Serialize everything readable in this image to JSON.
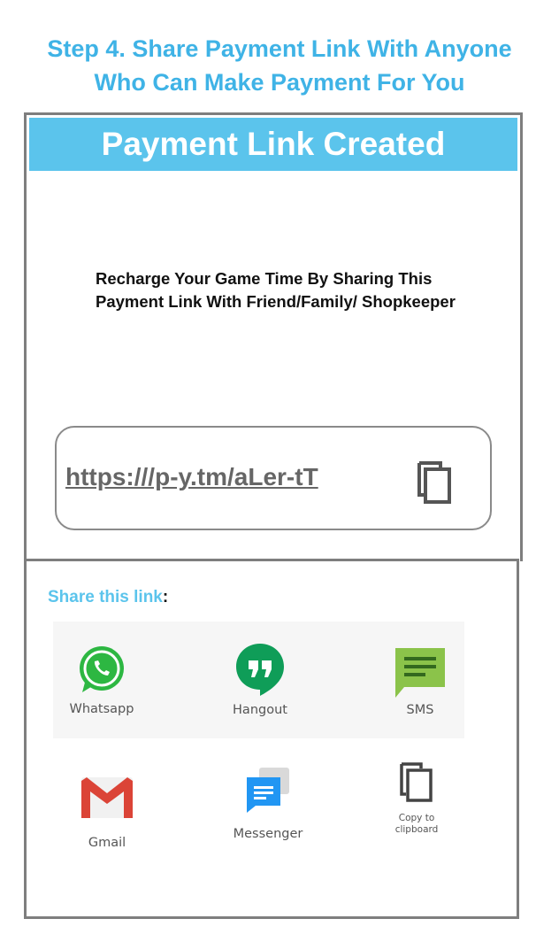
{
  "heading": {
    "line1": "Step 4. Share Payment Link With Anyone",
    "line2": "Who Can Make Payment For You"
  },
  "dialog": {
    "title": "Payment Link Created",
    "instruction": "Recharge Your Game Time By Sharing This Payment Link With Friend/Family/ Shopkeeper",
    "link": "https:///p-y.tm/aLer-tT"
  },
  "share": {
    "label": "Share this link",
    "colon": ":",
    "options": [
      {
        "label": "Whatsapp",
        "icon": "whatsapp-icon",
        "color": "#2db742"
      },
      {
        "label": "Hangout",
        "icon": "hangouts-icon",
        "color": "#0f9d58"
      },
      {
        "label": "SMS",
        "icon": "sms-icon",
        "color": "#8bc34a"
      },
      {
        "label": "Gmail",
        "icon": "gmail-icon",
        "color": "#db4437"
      },
      {
        "label": "Messenger",
        "icon": "messenger-icon",
        "color": "#2196f3"
      },
      {
        "label": "Copy to clipboard",
        "icon": "copy-icon",
        "color": "#555555"
      }
    ]
  }
}
